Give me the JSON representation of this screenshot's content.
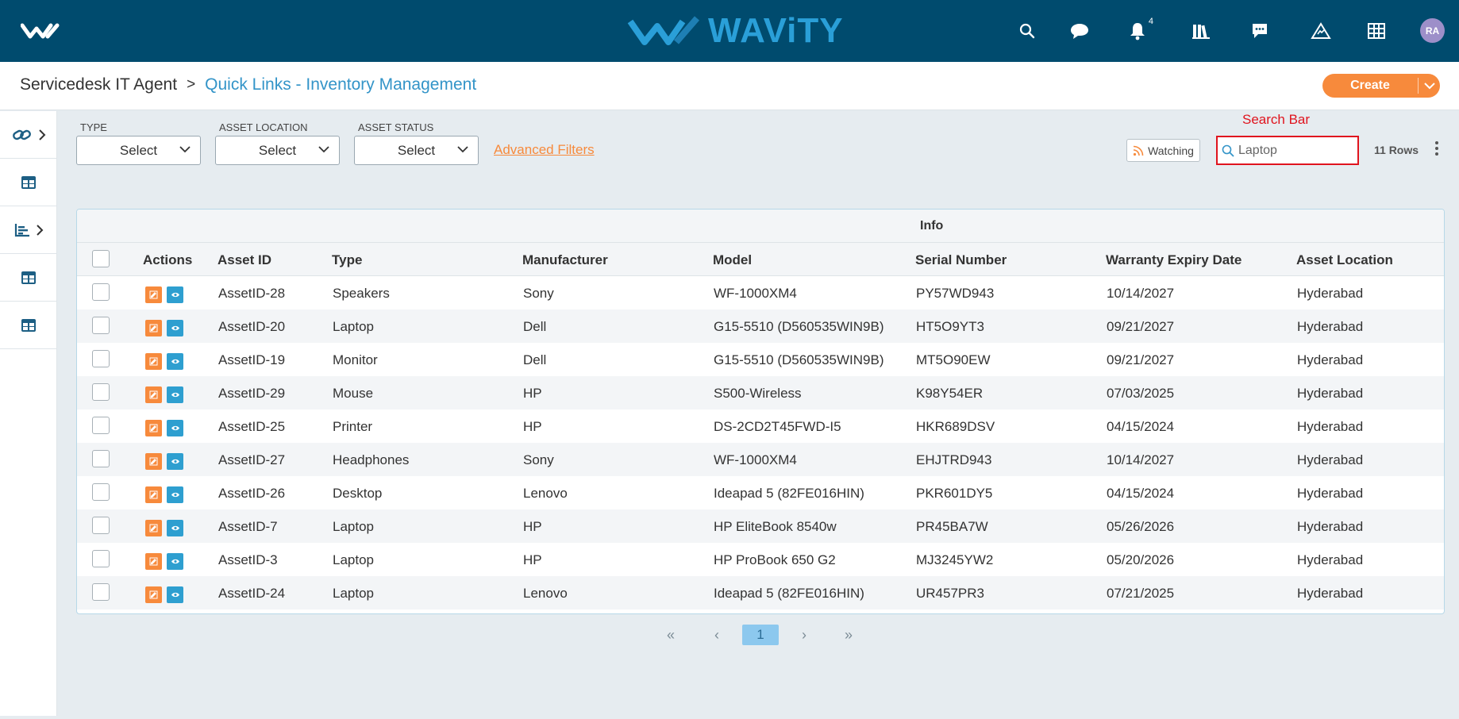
{
  "topbar": {
    "brand": "WAViTY",
    "notification_count": "4",
    "avatar_initials": "RA",
    "icons": [
      "search-icon",
      "chat-icon",
      "bell-icon",
      "library-icon",
      "message-icon",
      "warning-icon",
      "grid-icon"
    ]
  },
  "breadcrumb": {
    "root": "Servicedesk IT Agent",
    "separator": ">",
    "current": "Quick Links - Inventory Management"
  },
  "toolbar": {
    "create_label": "Create"
  },
  "filters": {
    "type_label": "TYPE",
    "type_value": "Select",
    "location_label": "ASSET LOCATION",
    "location_value": "Select",
    "status_label": "ASSET STATUS",
    "status_value": "Select",
    "advanced_label": "Advanced Filters",
    "watching_label": "Watching",
    "search_note": "Search Bar",
    "search_value": "Laptop",
    "rows_label": "11 Rows"
  },
  "table": {
    "group_header": "Info",
    "columns": {
      "actions": "Actions",
      "asset_id": "Asset ID",
      "type": "Type",
      "manufacturer": "Manufacturer",
      "model": "Model",
      "serial": "Serial Number",
      "warranty": "Warranty Expiry Date",
      "location": "Asset Location"
    },
    "rows": [
      {
        "asset_id": "AssetID-28",
        "type": "Speakers",
        "manufacturer": "Sony",
        "model": "WF-1000XM4",
        "serial": "PY57WD943",
        "warranty": "10/14/2027",
        "location": "Hyderabad"
      },
      {
        "asset_id": "AssetID-20",
        "type": "Laptop",
        "manufacturer": "Dell",
        "model": "G15-5510 (D560535WIN9B)",
        "serial": "HT5O9YT3",
        "warranty": "09/21/2027",
        "location": "Hyderabad"
      },
      {
        "asset_id": "AssetID-19",
        "type": "Monitor",
        "manufacturer": "Dell",
        "model": "G15-5510 (D560535WIN9B)",
        "serial": "MT5O90EW",
        "warranty": "09/21/2027",
        "location": "Hyderabad"
      },
      {
        "asset_id": "AssetID-29",
        "type": "Mouse",
        "manufacturer": "HP",
        "model": "S500-Wireless",
        "serial": "K98Y54ER",
        "warranty": "07/03/2025",
        "location": "Hyderabad"
      },
      {
        "asset_id": "AssetID-25",
        "type": "Printer",
        "manufacturer": "HP",
        "model": "DS-2CD2T45FWD-I5",
        "serial": "HKR689DSV",
        "warranty": "04/15/2024",
        "location": "Hyderabad"
      },
      {
        "asset_id": "AssetID-27",
        "type": "Headphones",
        "manufacturer": "Sony",
        "model": "WF-1000XM4",
        "serial": "EHJTRD943",
        "warranty": "10/14/2027",
        "location": "Hyderabad"
      },
      {
        "asset_id": "AssetID-26",
        "type": "Desktop",
        "manufacturer": "Lenovo",
        "model": "Ideapad 5 (82FE016HIN)",
        "serial": "PKR601DY5",
        "warranty": "04/15/2024",
        "location": "Hyderabad"
      },
      {
        "asset_id": "AssetID-7",
        "type": "Laptop",
        "manufacturer": "HP",
        "model": "HP EliteBook 8540w",
        "serial": "PR45BA7W",
        "warranty": "05/26/2026",
        "location": "Hyderabad"
      },
      {
        "asset_id": "AssetID-3",
        "type": "Laptop",
        "manufacturer": "HP",
        "model": "HP ProBook 650 G2",
        "serial": "MJ3245YW2",
        "warranty": "05/20/2026",
        "location": "Hyderabad"
      },
      {
        "asset_id": "AssetID-24",
        "type": "Laptop",
        "manufacturer": "Lenovo",
        "model": "Ideapad 5 (82FE016HIN)",
        "serial": "UR457PR3",
        "warranty": "07/21/2025",
        "location": "Hyderabad"
      }
    ]
  },
  "pagination": {
    "first": "«",
    "prev": "‹",
    "current": "1",
    "next": "›",
    "last": "»"
  },
  "colors": {
    "topbar": "#004b6e",
    "brand": "#2a9fd8",
    "accent_orange": "#f78a3c",
    "accent_blue": "#2e9fd0",
    "search_highlight": "#e0141e"
  }
}
